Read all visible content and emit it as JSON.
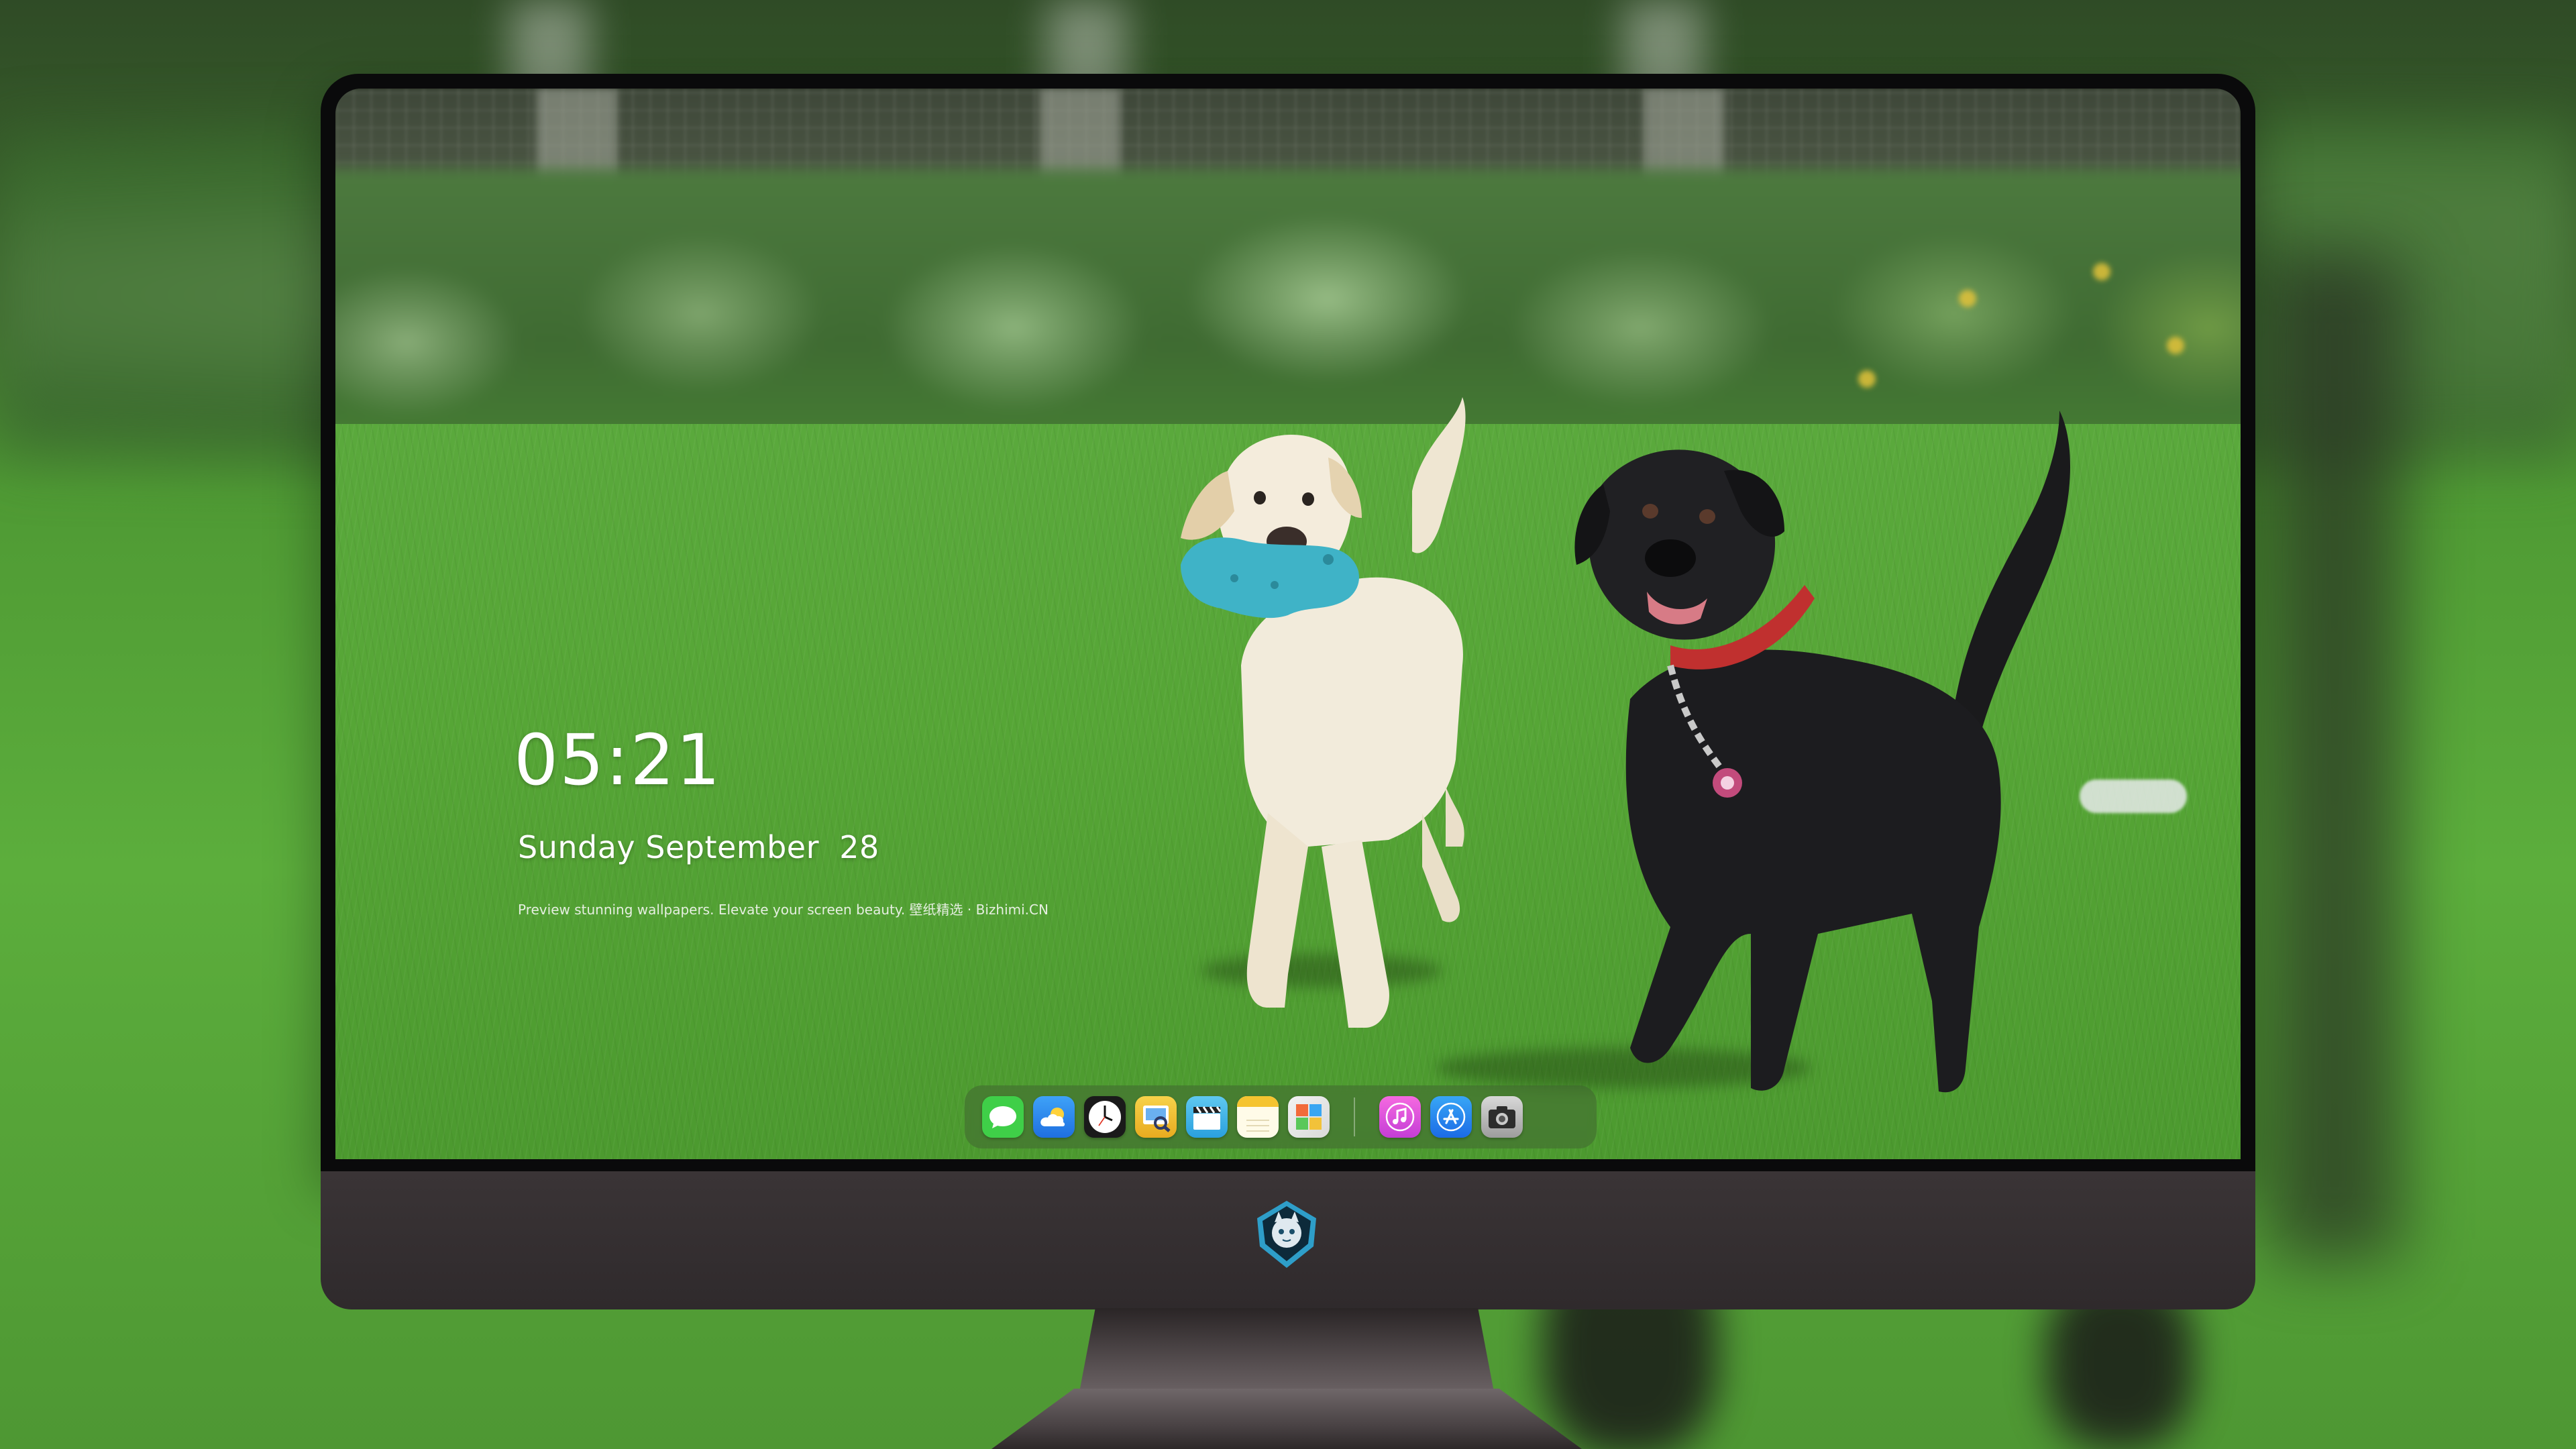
{
  "lockscreen": {
    "time": "05:21",
    "date": "Sunday September  28",
    "tagline": "Preview stunning wallpapers. Elevate your screen beauty. 壁纸精选 · Bizhimi.CN"
  },
  "dock": {
    "apps_left": [
      {
        "name": "Messages",
        "icon": "messages-icon"
      },
      {
        "name": "Weather",
        "icon": "weather-icon"
      },
      {
        "name": "Clock",
        "icon": "clock-icon"
      },
      {
        "name": "Preview",
        "icon": "preview-icon"
      },
      {
        "name": "Videos",
        "icon": "clapperboard-icon"
      },
      {
        "name": "Notes",
        "icon": "notes-icon"
      },
      {
        "name": "Photos",
        "icon": "photos-icon"
      }
    ],
    "apps_right": [
      {
        "name": "Music",
        "icon": "music-icon"
      },
      {
        "name": "App Store",
        "icon": "app-store-icon"
      },
      {
        "name": "Camera",
        "icon": "camera-icon"
      }
    ]
  },
  "monitor": {
    "logo": "mascot-logo-icon"
  },
  "colors": {
    "chin": "#332d2f",
    "bezel": "#0a0a0b",
    "messages": "#3fcf48",
    "weather": "#2f8ff0",
    "music": "#e94fd2",
    "appstore": "#2a7df3"
  }
}
